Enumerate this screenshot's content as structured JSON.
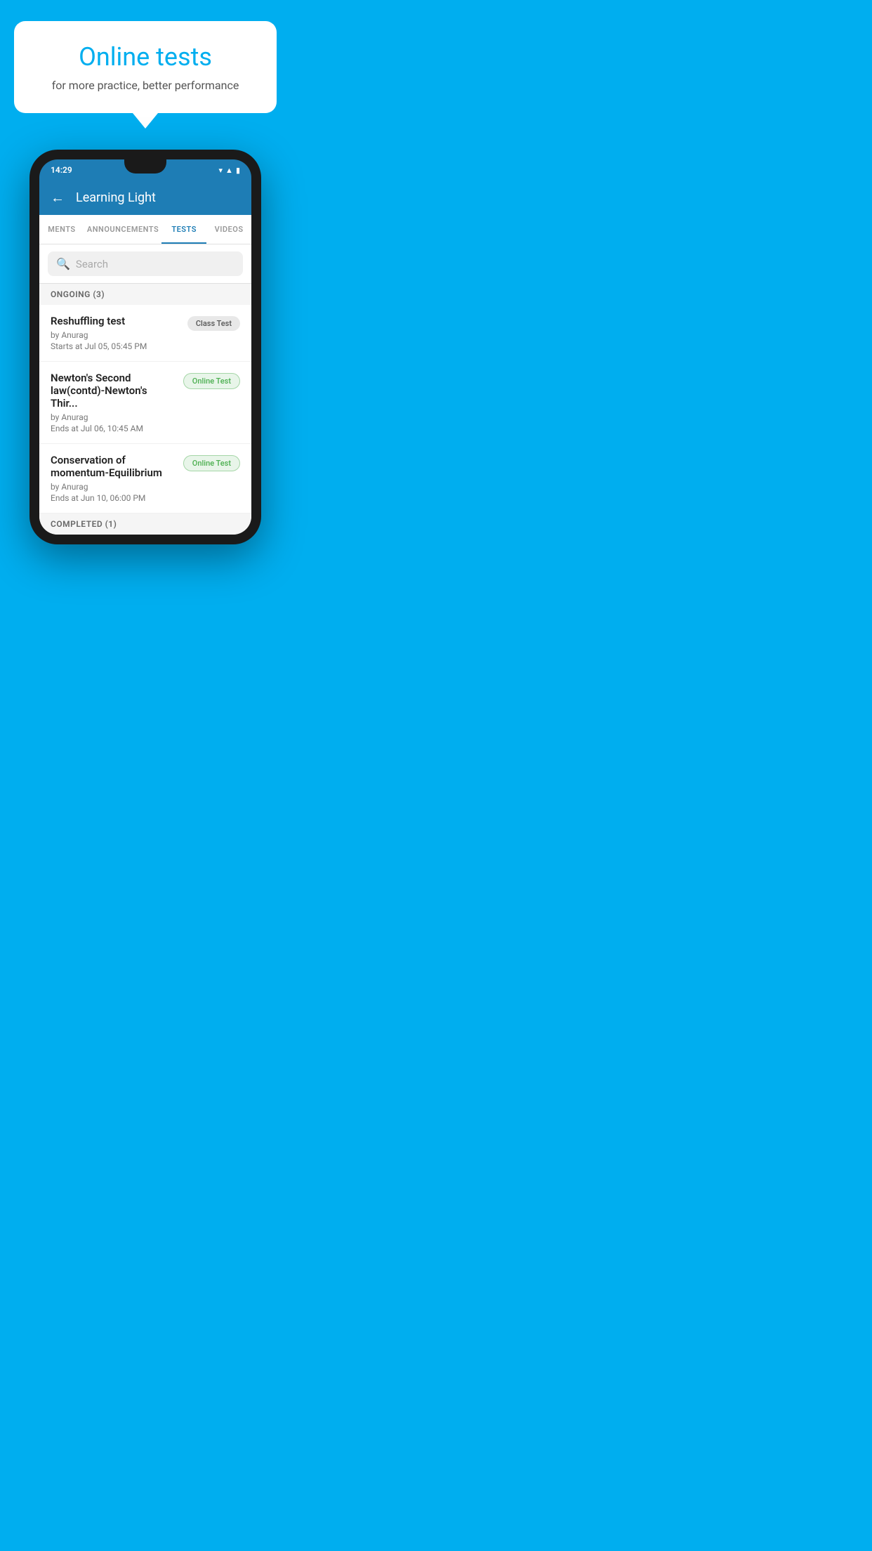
{
  "page": {
    "background_color": "#00AEEF"
  },
  "speech_bubble": {
    "title": "Online tests",
    "subtitle": "for more practice, better performance"
  },
  "phone": {
    "status_bar": {
      "time": "14:29",
      "icons": [
        "wifi",
        "signal",
        "battery"
      ]
    },
    "app": {
      "title": "Learning Light",
      "back_label": "←"
    },
    "tabs": [
      {
        "label": "MENTS",
        "active": false
      },
      {
        "label": "ANNOUNCEMENTS",
        "active": false
      },
      {
        "label": "TESTS",
        "active": true
      },
      {
        "label": "VIDEOS",
        "active": false
      }
    ],
    "search": {
      "placeholder": "Search",
      "icon": "🔍"
    },
    "sections": [
      {
        "label": "ONGOING (3)",
        "tests": [
          {
            "name": "Reshuffling test",
            "author": "by Anurag",
            "date": "Starts at  Jul 05, 05:45 PM",
            "badge": "Class Test",
            "badge_type": "class"
          },
          {
            "name": "Newton's Second law(contd)-Newton's Thir...",
            "author": "by Anurag",
            "date": "Ends at  Jul 06, 10:45 AM",
            "badge": "Online Test",
            "badge_type": "online"
          },
          {
            "name": "Conservation of momentum-Equilibrium",
            "author": "by Anurag",
            "date": "Ends at  Jun 10, 06:00 PM",
            "badge": "Online Test",
            "badge_type": "online"
          }
        ]
      }
    ],
    "completed_label": "COMPLETED (1)"
  }
}
